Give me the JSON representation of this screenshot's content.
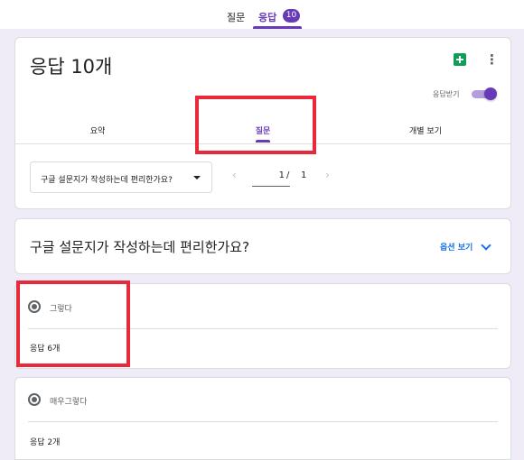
{
  "top_nav": {
    "questions_tab": "질문",
    "responses_tab": "응답",
    "responses_badge": "10"
  },
  "summary_card": {
    "title": "응답 10개",
    "accepting_label": "응답받기",
    "tabs": {
      "summary": "요약",
      "questions": "질문",
      "individual": "개별 보기"
    },
    "question_select": "구글 설문지가 작성하는데 편리한가요?",
    "pagination": {
      "current": "1",
      "separator": "/",
      "total": "1"
    }
  },
  "question_card": {
    "title": "구글 설문지가 작성하는데 편리한가요?",
    "options_view": "옵션 보기"
  },
  "answers": [
    {
      "label": "그렇다",
      "count": "응답 6개"
    },
    {
      "label": "매우그렇다",
      "count": "응답 2개"
    }
  ],
  "icons": {
    "sheets": "sheets-icon",
    "more": "more-vert-icon",
    "prev": "chevron-left-icon",
    "next": "chevron-right-icon",
    "dropdown": "arrow-drop-down-icon"
  },
  "colors": {
    "accent": "#673ab7",
    "link": "#1a73e8",
    "sheets": "#0f9d58",
    "highlight": "#e8293b"
  }
}
